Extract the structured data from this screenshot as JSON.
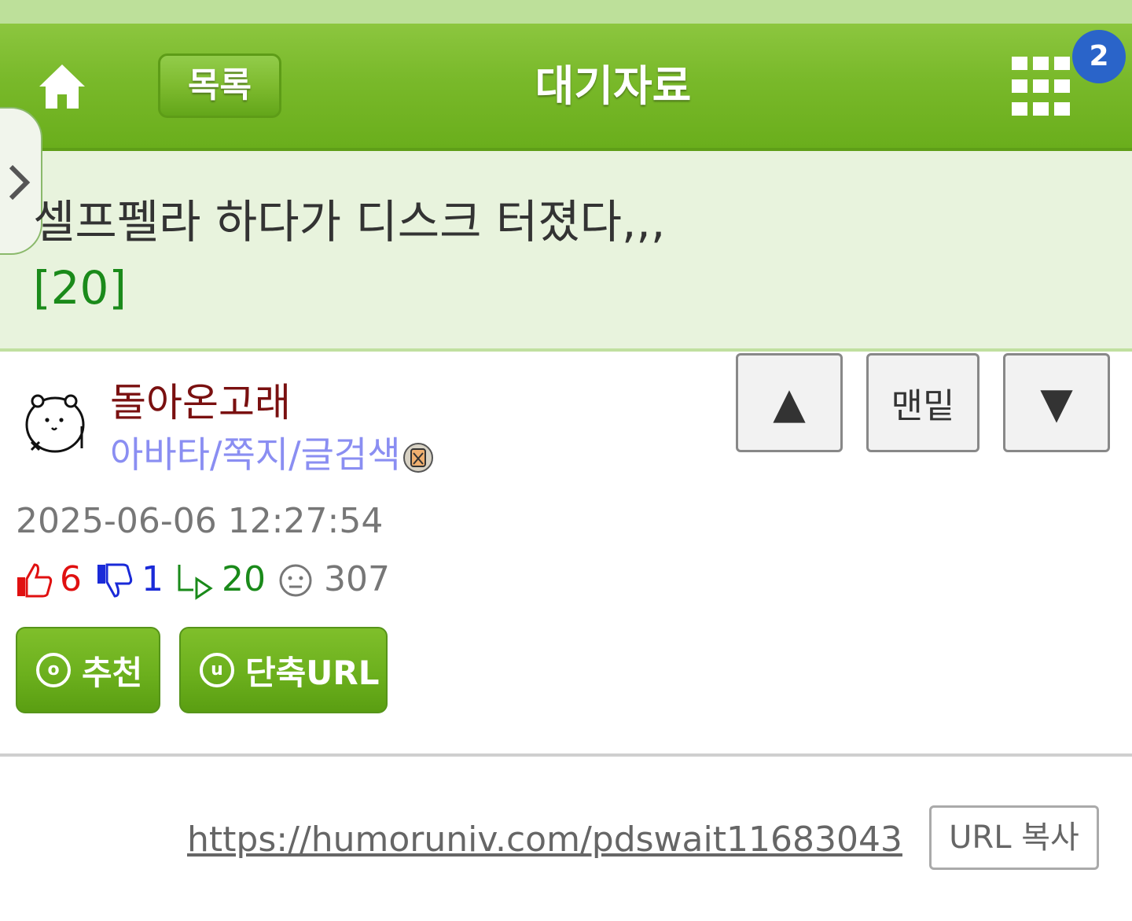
{
  "header": {
    "list_label": "목록",
    "title": "대기자료",
    "badge_count": "2",
    "icons": [
      "home-icon",
      "grid-menu-icon"
    ]
  },
  "post": {
    "title": "셀프펠라 하다가 디스크 터졌다,,,",
    "reply_count": "[20]"
  },
  "nav": {
    "up_label": "▲",
    "bottom_label": "맨밑",
    "down_label": "▼"
  },
  "author": {
    "name": "돌아온고래",
    "links": "아바타/쪽지/글검색"
  },
  "meta": {
    "datetime": "2025-06-06 12:27:54",
    "likes": "6",
    "dislikes": "1",
    "replies": "20",
    "views": "307"
  },
  "actions": {
    "recommend_label": "추천",
    "shorturl_label": "단축URL",
    "recommend_icon_letter": "o",
    "shorturl_icon_letter": "u"
  },
  "url": {
    "link_text": "https://humoruniv.com/pdswait11683043",
    "copy_label": "URL 복사"
  },
  "colors": {
    "header_green": "#79b92a",
    "like_red": "#e01010",
    "dislike_blue": "#1a2ad8",
    "reply_green": "#1a8a1a",
    "author_color": "#7a1010",
    "link_purple": "#8a8ef2",
    "badge_blue": "#2a64c9"
  }
}
